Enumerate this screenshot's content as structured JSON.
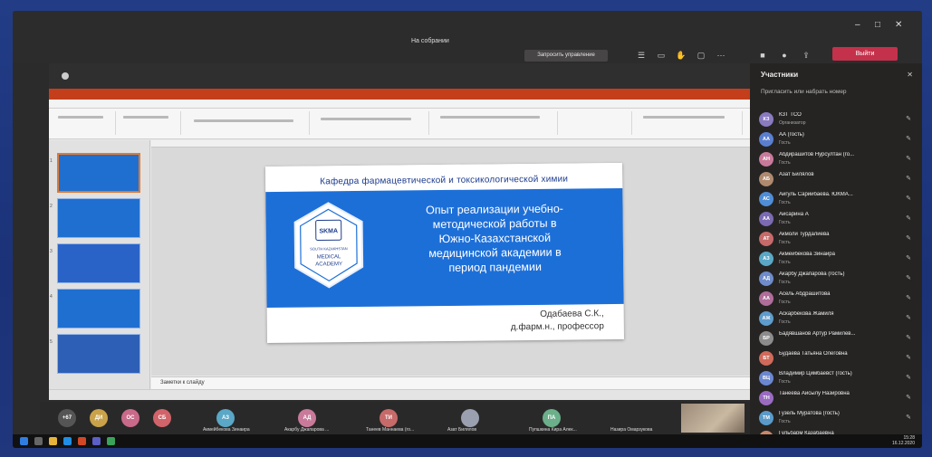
{
  "window": {
    "title": "На собрании",
    "minimize": "–",
    "maximize": "□",
    "close": "✕"
  },
  "toolbar": {
    "request_control": "Запросить управление",
    "leave": "Выйти",
    "timer": "",
    "icons": [
      "people-icon",
      "chat-icon",
      "hand-icon",
      "breakout-icon",
      "more-icon",
      "camera-icon",
      "mic-icon",
      "share-icon"
    ]
  },
  "ppt": {
    "notes_placeholder": "Заметки к слайду"
  },
  "slide": {
    "department": "Кафедра фармацевтической и токсикологической химии",
    "title_lines": [
      "Опыт реализации учебно-",
      "методической работы в",
      "Южно-Казахстанской",
      "медицинской академии в",
      "период пандемии"
    ],
    "author_lines": [
      "Одабаева С.К.,",
      "д.фарм.н., профессор"
    ],
    "logo_text": {
      "top": "SKMA",
      "ring": "SOUTH KAZAKHSTAN",
      "line1": "MEDICAL",
      "line2": "ACADEMY"
    }
  },
  "thumbnails": [
    {
      "num": "1"
    },
    {
      "num": "2"
    },
    {
      "num": "3"
    },
    {
      "num": "4"
    },
    {
      "num": "5"
    }
  ],
  "panel": {
    "title": "Участники",
    "search_placeholder": "Пригласить или набрать номер",
    "participants": [
      {
        "initials": "КЗ",
        "name": "КЗТ ТСО",
        "role": "Организатор",
        "color": "#8a7ac0"
      },
      {
        "initials": "АА",
        "name": "АА (гость)",
        "role": "Гость",
        "color": "#5b7fd0"
      },
      {
        "initials": "АН",
        "name": "Абдирашитов Нурсултан (го...",
        "role": "Гость",
        "color": "#c97a9b"
      },
      {
        "initials": "АБ",
        "name": "Азат Билялов",
        "role": "",
        "color": "#b08a6e"
      },
      {
        "initials": "АС",
        "name": "Айгуль Сариибаева. ЮКМА...",
        "role": "Гость",
        "color": "#4f8dd6"
      },
      {
        "initials": "АА",
        "name": "Айсарина А",
        "role": "Гость",
        "color": "#7c6ab3"
      },
      {
        "initials": "АТ",
        "name": "Акмолй Турдалиева",
        "role": "Гость",
        "color": "#c76a6a"
      },
      {
        "initials": "АЗ",
        "name": "Акмейбекова Зинаира",
        "role": "Гость",
        "color": "#5aa7c6"
      },
      {
        "initials": "АД",
        "name": "Акарбу Джапарова (гость)",
        "role": "Гость",
        "color": "#6f8bc9"
      },
      {
        "initials": "АА",
        "name": "Асель Абдрашитова",
        "role": "Гость",
        "color": "#b06d9a"
      },
      {
        "initials": "АЖ",
        "name": "Аскарбекова Жамиля",
        "role": "Гость",
        "color": "#5e9ccc"
      },
      {
        "initials": "БР",
        "name": "Бадявшанов Артур Рамилев...",
        "role": "",
        "color": "#8c8c8c"
      },
      {
        "initials": "БТ",
        "name": "Будаева Татьяна Олеговна",
        "role": "",
        "color": "#d06a5a"
      },
      {
        "initials": "ВЦ",
        "name": "Владимир Цимбаевст (гость)",
        "role": "Гость",
        "color": "#6b87cf"
      },
      {
        "initials": "ТН",
        "name": "Танеева Айсылу Назировна",
        "role": "",
        "color": "#9b6bc2"
      },
      {
        "initials": "ТМ",
        "name": "Гузель Муратова (гость)",
        "role": "Гость",
        "color": "#5a9acb"
      },
      {
        "initials": "ТК",
        "name": "Гульбарм Казабаевна",
        "role": "",
        "color": "#c9876a"
      }
    ]
  },
  "strip": {
    "avatars": [
      {
        "initials": "+67",
        "color": "#555"
      },
      {
        "initials": "ДИ",
        "color": "#c9a24a"
      },
      {
        "initials": "ОС",
        "color": "#c96a8a"
      },
      {
        "initials": "СБ",
        "color": "#d0646a"
      },
      {
        "initials": "АЗ",
        "color": "#5aa7c6"
      },
      {
        "initials": "АД",
        "color": "#c97a9b"
      },
      {
        "initials": "ТИ",
        "color": "#c76a6a"
      },
      {
        "initials": "",
        "color": "#9aa0b0"
      },
      {
        "initials": "ПА",
        "color": "#6bb08a"
      }
    ],
    "names": [
      "Акмейбекова Зинаира",
      "Акарбу Джапарова ...",
      "Танеев Маннаева (го...",
      "Азат Билялов",
      "Пупшкина Кира Алек...",
      "Назира Омарзукова"
    ]
  },
  "clock": {
    "time": "15:28",
    "date": "16.12.2020"
  }
}
